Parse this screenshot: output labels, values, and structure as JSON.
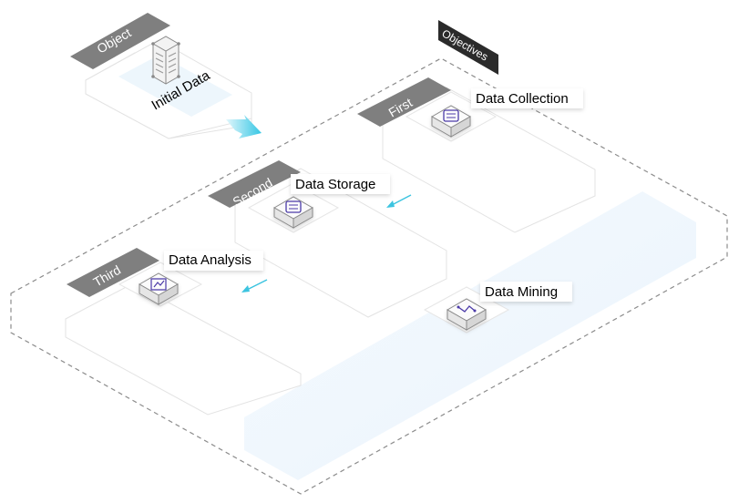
{
  "diagram": {
    "object_tag": "Object",
    "objectives_tag": "Objectives",
    "initial_data_label": "Initial Data",
    "steps": [
      {
        "tag": "First",
        "label": "Data Collection"
      },
      {
        "tag": "Second",
        "label": "Data Storage"
      },
      {
        "tag": "Third",
        "label": "Data Analysis"
      }
    ],
    "mining_label": "Data Mining"
  },
  "colors": {
    "tag_fill": "#7f7f7f",
    "objectives_fill": "#2b2b2b",
    "arrow": "#3cc4e0",
    "icon_purple": "#4b3aa8",
    "panel_stroke": "#e3e3e3",
    "dashed_border": "#8c8c8c",
    "soft_blue": "#eef6fd"
  }
}
